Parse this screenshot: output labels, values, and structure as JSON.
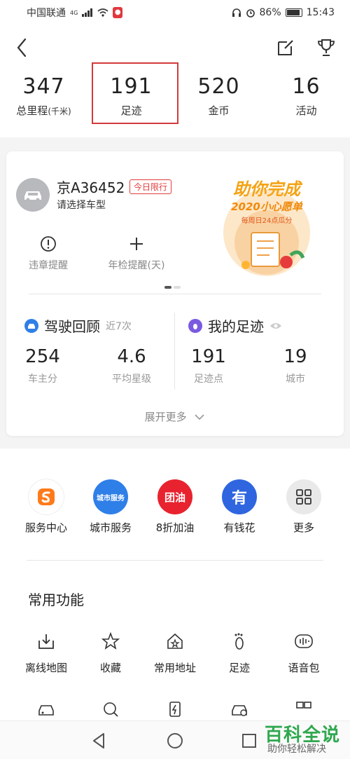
{
  "status_bar": {
    "carrier": "中国联通",
    "network": "4G",
    "battery": "86%",
    "time": "15:43"
  },
  "stats": [
    {
      "value": "347",
      "label": "总里程",
      "unit": "(千米)"
    },
    {
      "value": "191",
      "label": "足迹",
      "unit": ""
    },
    {
      "value": "520",
      "label": "金币",
      "unit": ""
    },
    {
      "value": "16",
      "label": "活动",
      "unit": ""
    }
  ],
  "vehicle": {
    "plate": "京A36452",
    "restriction_badge": "今日限行",
    "model_prompt": "请选择车型",
    "violation_label": "违章提醒",
    "inspection_label": "年检提醒(天)"
  },
  "banner": {
    "title": "助你完成",
    "subtitle": "2020小心愿单",
    "caption": "每周日24点瓜分"
  },
  "driving_review": {
    "title": "驾驶回顾",
    "subtitle": "近7次",
    "owner_score": "254",
    "owner_score_label": "车主分",
    "avg_rating": "4.6",
    "avg_rating_label": "平均星级"
  },
  "my_footprint": {
    "title": "我的足迹",
    "points": "191",
    "points_label": "足迹点",
    "cities": "19",
    "cities_label": "城市"
  },
  "expand_more": "展开更多",
  "services": [
    {
      "label": "服务中心",
      "icon_text": "S",
      "color": "#ffffff"
    },
    {
      "label": "城市服务",
      "icon_text": "城市服务",
      "color": "#2f7fe8"
    },
    {
      "label": "8折加油",
      "icon_text": "团油",
      "color": "#e8232f"
    },
    {
      "label": "有钱花",
      "icon_text": "有",
      "color": "#2f66e0"
    },
    {
      "label": "更多",
      "icon_text": "",
      "color": "#e9e9e9"
    }
  ],
  "common": {
    "title": "常用功能",
    "items": [
      "离线地图",
      "收藏",
      "常用地址",
      "足迹",
      "语音包"
    ]
  },
  "watermark": {
    "title": "百科全说",
    "subtitle": "助你轻松解决"
  }
}
